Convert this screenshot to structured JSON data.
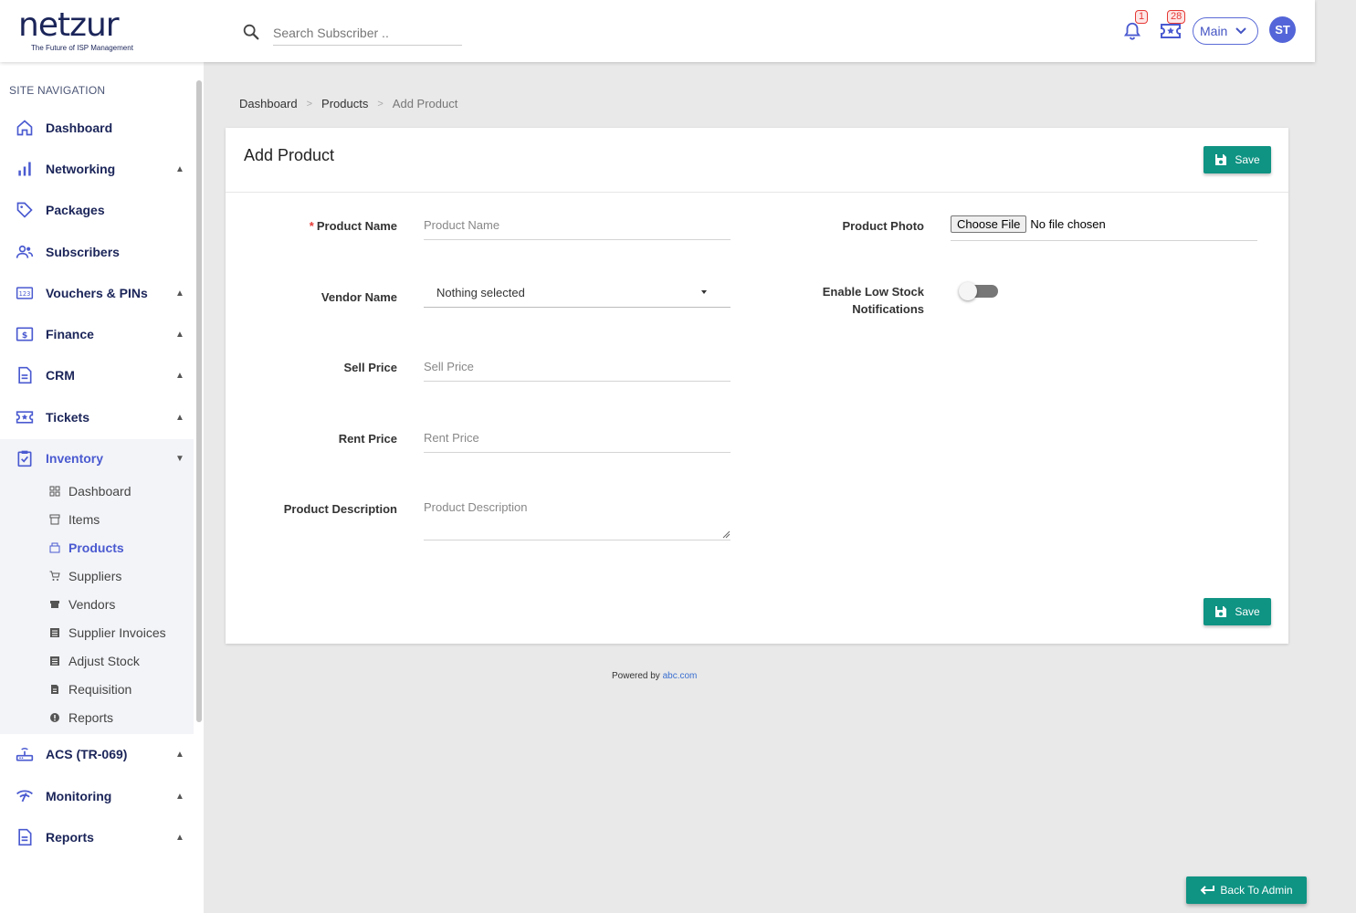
{
  "header": {
    "logo_text": "netzur",
    "logo_tagline": "The Future of ISP Management",
    "search_placeholder": "Search Subscriber ..",
    "notifications_count": "1",
    "tickets_count": "28",
    "branch_label": "Main",
    "avatar_initials": "ST"
  },
  "sidebar": {
    "title": "SITE NAVIGATION",
    "items": [
      {
        "label": "Dashboard",
        "icon": "home-icon"
      },
      {
        "label": "Networking",
        "icon": "bar-chart-icon"
      },
      {
        "label": "Packages",
        "icon": "tag-icon"
      },
      {
        "label": "Subscribers",
        "icon": "users-icon"
      },
      {
        "label": "Vouchers & PINs",
        "icon": "pin-123-icon"
      },
      {
        "label": "Finance",
        "icon": "dollar-icon"
      },
      {
        "label": "CRM",
        "icon": "document-icon"
      },
      {
        "label": "Tickets",
        "icon": "ticket-icon"
      },
      {
        "label": "Inventory",
        "icon": "clipboard-check-icon"
      },
      {
        "label": "ACS (TR-069)",
        "icon": "router-icon"
      },
      {
        "label": "Monitoring",
        "icon": "wifi-signal-icon"
      },
      {
        "label": "Reports",
        "icon": "report-icon"
      }
    ],
    "inventory_sub": [
      {
        "label": "Dashboard",
        "icon": "grid-icon"
      },
      {
        "label": "Items",
        "icon": "archive-icon"
      },
      {
        "label": "Products",
        "icon": "products-icon"
      },
      {
        "label": "Suppliers",
        "icon": "cart-icon"
      },
      {
        "label": "Vendors",
        "icon": "store-icon"
      },
      {
        "label": "Supplier Invoices",
        "icon": "invoice-icon"
      },
      {
        "label": "Adjust Stock",
        "icon": "list-icon"
      },
      {
        "label": "Requisition",
        "icon": "file-icon"
      },
      {
        "label": "Reports",
        "icon": "info-icon"
      }
    ]
  },
  "breadcrumb": [
    "Dashboard",
    "Products",
    "Add Product"
  ],
  "form": {
    "title": "Add Product",
    "save_label": "Save",
    "product_name_label": "Product Name",
    "product_name_placeholder": "Product Name",
    "vendor_name_label": "Vendor Name",
    "vendor_name_value": "Nothing selected",
    "sell_price_label": "Sell Price",
    "sell_price_placeholder": "Sell Price",
    "rent_price_label": "Rent Price",
    "rent_price_placeholder": "Rent Price",
    "description_label": "Product Description",
    "description_placeholder": "Product Description",
    "photo_label": "Product Photo",
    "file_button": "Choose File",
    "file_status": "No file chosen",
    "low_stock_label_1": "Enable Low Stock",
    "low_stock_label_2": "Notifications",
    "low_stock_enabled": false
  },
  "footer": {
    "powered_by": "Powered by",
    "powered_link": "abc.com",
    "back_label": "Back To Admin"
  },
  "colors": {
    "primary_navy": "#1b2559",
    "accent_blue": "#4a5ad0",
    "save_green": "#0f9383",
    "badge_red": "#e53935"
  }
}
